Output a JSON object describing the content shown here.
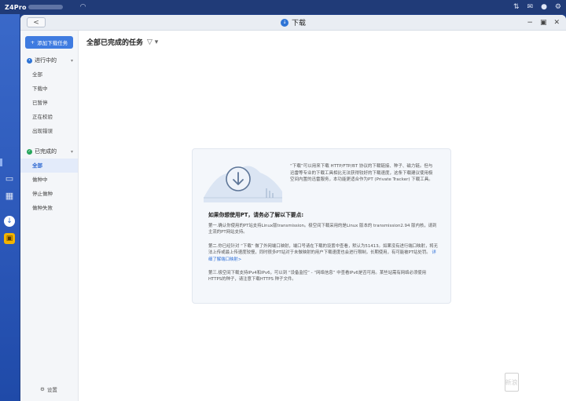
{
  "os": {
    "device_name": "Z4Pro",
    "topbar_icons": [
      "tune-icon",
      "inbox-icon",
      "user-icon",
      "settings-icon"
    ]
  },
  "window": {
    "back_label": "<",
    "title": "下载",
    "controls": [
      "−",
      "▣",
      "✕"
    ]
  },
  "sidebar": {
    "add_task": "添加下载任务",
    "group_active": "进行中的",
    "active_items": [
      "全部",
      "下载中",
      "已暂停",
      "正在校验",
      "出现错误"
    ],
    "group_done": "已完成的",
    "done_items": [
      "全部",
      "做种中",
      "停止做种",
      "做种失败"
    ],
    "settings": "设置"
  },
  "main": {
    "header": "全部已完成的任务"
  },
  "card": {
    "intro": "“下载”可以用来下载 HTTP/FTP/BT 协议的下载链接、种子、磁力链。但与迅雷等专业的下载工具相比无法获得较好的下载速度，这条下载建议使用极空间内置的迅雷服务，本功能更适合作为PT (Private Tracker) 下载工具。",
    "req_title": "如果你想使用PT，请务必了解以下要点:",
    "p1": "第一.确认你使用的PT站支持Linux版transmission。极空间下载采用的是Linux 版本的 transmission2.94 版内核，请到主流的PT网站支持。",
    "p2": "第二.你已经针对 “下载” 做了外网端口映射，端口号请在下载的设置中查看，默认为51413。如果没有进行端口映射，将无法上传或最上传速度较慢，同时很多PT站对于未做映射的用户下载速度也会进行限制，长期使用，有可能被PT站处罚。",
    "p2_link": "详细了解端口映射>",
    "p3": "第三.极空间下载支持IPv4和IPv6，可以到 “设备监控” - “网络信息” 中查看IPv6是否可用。某些站需有网络必须使用HTTPS的种子，请注意下载HTTPS 种子文件。"
  },
  "watermark": {
    "text": "值 众测",
    "badge": "新浪"
  }
}
